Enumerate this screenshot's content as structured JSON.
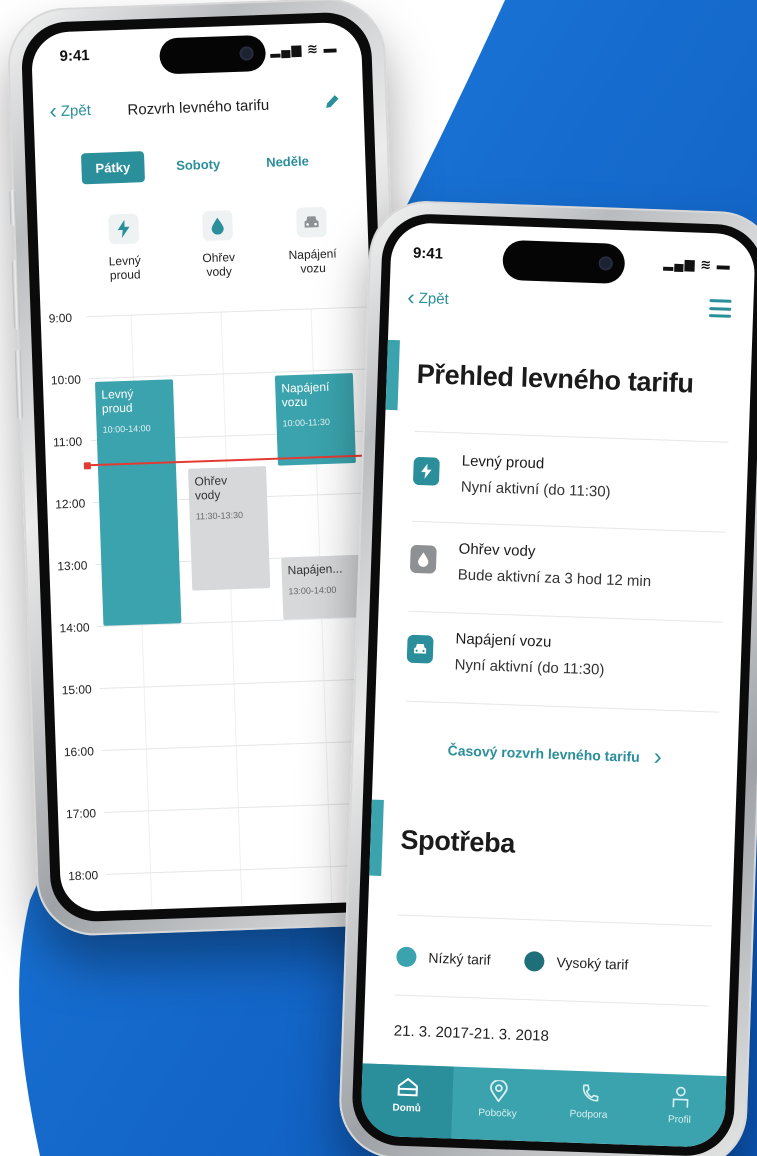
{
  "colors": {
    "accent": "#2a8f9a",
    "accent_light": "#3aa3ad",
    "now_line": "#e33b34",
    "background_blue": "#1568cf"
  },
  "back_phone": {
    "status_time": "9:41",
    "back_label": "Zpět",
    "title": "Rozvrh levného tarifu",
    "tabs": [
      {
        "label": "Pátky",
        "active": true
      },
      {
        "label": "Soboty",
        "active": false
      },
      {
        "label": "Neděle",
        "active": false
      }
    ],
    "categories": [
      {
        "line1": "Levný",
        "line2": "proud",
        "icon": "lightning-icon"
      },
      {
        "line1": "Ohřev",
        "line2": "vody",
        "icon": "water-drop-icon"
      },
      {
        "line1": "Napájení",
        "line2": "vozu",
        "icon": "car-icon"
      }
    ],
    "hours": [
      "9:00",
      "10:00",
      "11:00",
      "12:00",
      "13:00",
      "14:00",
      "15:00",
      "16:00",
      "17:00",
      "18:00"
    ],
    "events": [
      {
        "title_1": "Levný",
        "title_2": "proud",
        "time": "10:00-14:00"
      },
      {
        "title_1": "Ohřev",
        "title_2": "vody",
        "time": "11:30-13:30"
      },
      {
        "title_1": "Napájení",
        "title_2": "vozu",
        "time": "10:00-11:30"
      },
      {
        "title_1": "Napájen...",
        "title_2": "",
        "time": "13:00-14:00"
      }
    ]
  },
  "front_phone": {
    "status_time": "9:41",
    "back_label": "Zpět",
    "overview_title": "Přehled levného tarifu",
    "rows": [
      {
        "title": "Levný proud",
        "status": "Nyní aktivní (do 11:30)",
        "icon": "lightning-icon"
      },
      {
        "title": "Ohřev vody",
        "status": "Bude aktivní za 3 hod 12 min",
        "icon": "water-drop-icon"
      },
      {
        "title": "Napájení vozu",
        "status": "Nyní aktivní (do 11:30)",
        "icon": "car-icon"
      }
    ],
    "schedule_link": "Časový rozvrh levného tarifu",
    "consumption_title": "Spotřeba",
    "legend": [
      {
        "label": "Nízký tarif",
        "color": "#3aa3ad"
      },
      {
        "label": "Vysoký tarif",
        "color": "#1f6f7a"
      }
    ],
    "date_range": "21. 3. 2017-21. 3. 2018",
    "tabbar": [
      {
        "label": "Domů",
        "icon": "home-icon",
        "active": true
      },
      {
        "label": "Pobočky",
        "icon": "location-pin-icon",
        "active": false
      },
      {
        "label": "Podpora",
        "icon": "phone-icon",
        "active": false
      },
      {
        "label": "Profil",
        "icon": "person-icon",
        "active": false
      }
    ]
  }
}
